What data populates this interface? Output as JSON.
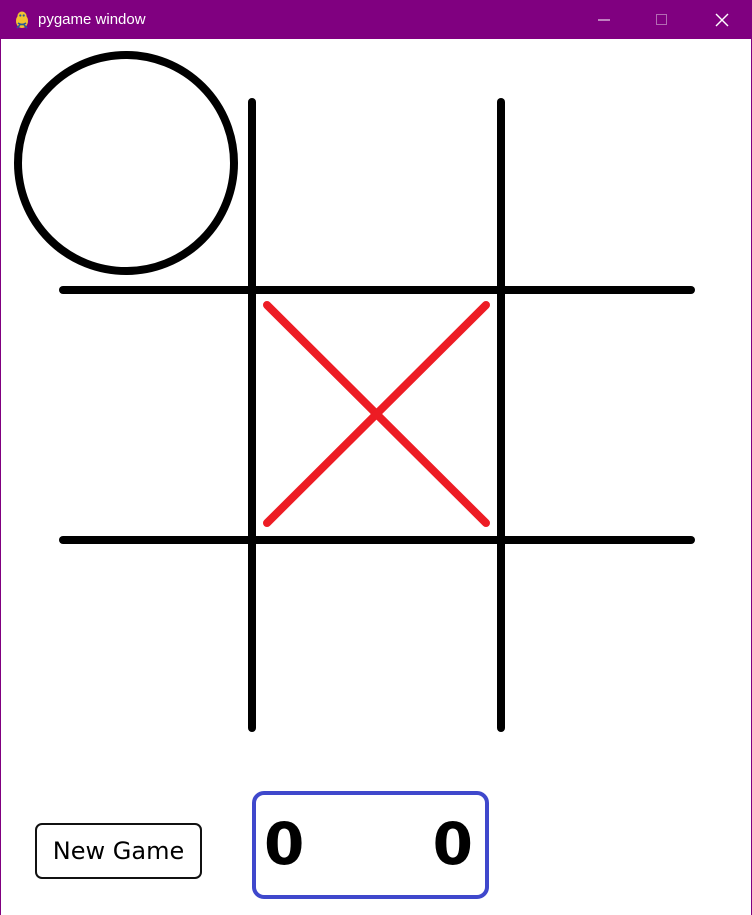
{
  "window": {
    "title": "pygame window",
    "titlebar_color": "#800080",
    "icon": "pygame-snake-icon",
    "controls": {
      "minimize_icon": "minimize-icon",
      "maximize_icon": "maximize-icon",
      "close_icon": "close-icon"
    }
  },
  "game": {
    "board": {
      "rows": 3,
      "cols": 3,
      "cells": [
        [
          "O",
          "",
          ""
        ],
        [
          "",
          "X",
          ""
        ],
        [
          "",
          "",
          ""
        ]
      ],
      "line_color": "#000000",
      "x_color": "#ed1c24",
      "o_color": "#000000"
    },
    "new_game_label": "New Game",
    "score": {
      "left": "0",
      "right": "0",
      "border_color": "#3f48cc"
    }
  }
}
